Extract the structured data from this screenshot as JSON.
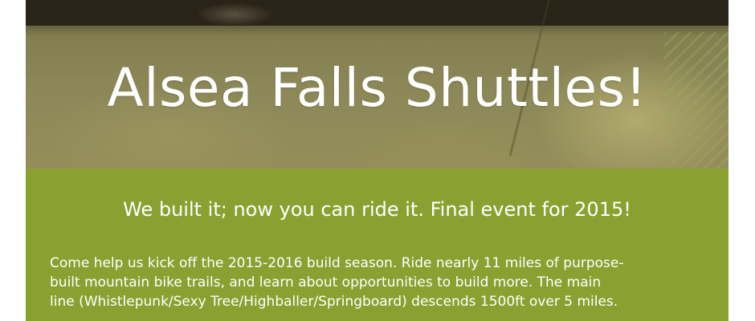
{
  "hero": {
    "title": "Alsea Falls Shuttles!"
  },
  "content": {
    "tagline": "We built it; now you can ride it. Final event for 2015!",
    "paragraph_lines": [
      "Come help us kick off the 2015-2016 build season.  Ride nearly 11 miles of purpose-",
      "built mountain bike trails, and learn about opportunities to build more.  The main",
      "line (Whistlepunk/Sexy Tree/Highballer/Springboard) descends 1500ft over 5 miles."
    ]
  },
  "colors": {
    "panel_green": "#8aa131",
    "overlay_olive": "#8c8c50",
    "text": "#ffffff"
  }
}
